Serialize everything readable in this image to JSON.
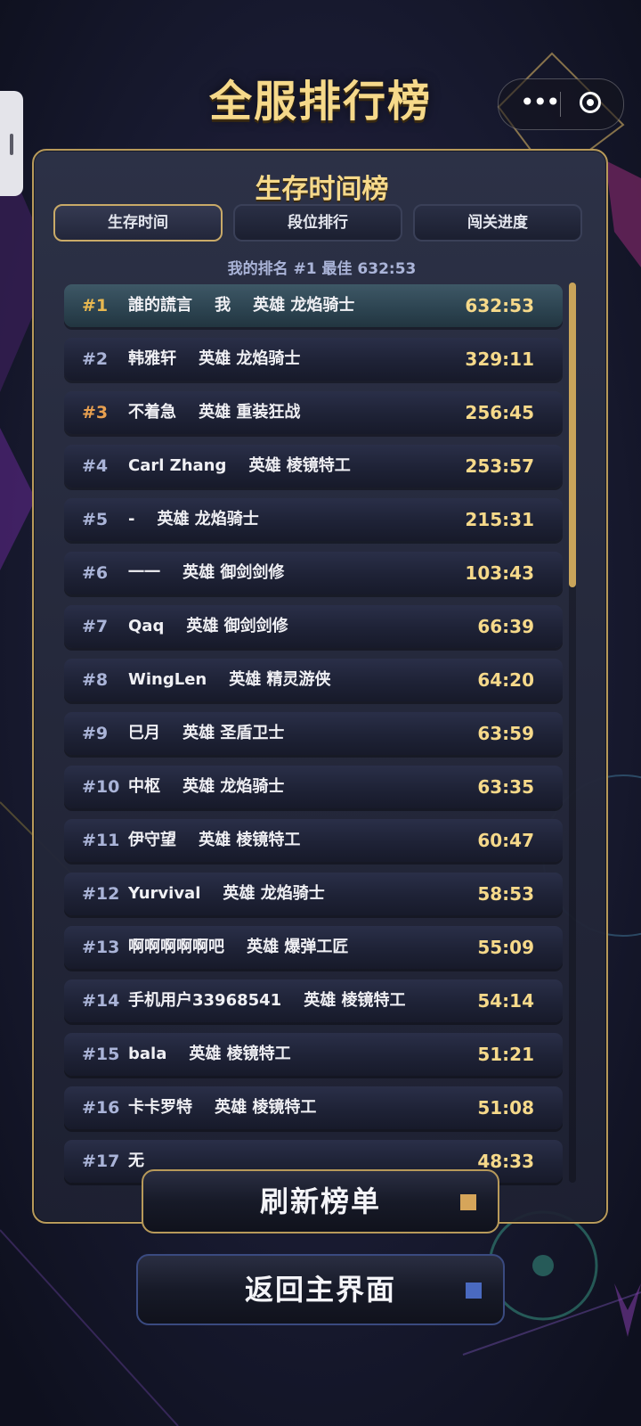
{
  "title": "全服排行榜",
  "panel": {
    "title": "生存时间榜",
    "tabs": [
      {
        "label": "生存时间",
        "active": true
      },
      {
        "label": "段位排行",
        "active": false
      },
      {
        "label": "闯关进度",
        "active": false
      }
    ],
    "my_rank": "我的排名 #1  最佳 632:53"
  },
  "rows": [
    {
      "rank": "#1",
      "name": "誰的謊言    我    英雄 龙焰骑士",
      "time": "632:53"
    },
    {
      "rank": "#2",
      "name": "韩雅轩    英雄 龙焰骑士",
      "time": "329:11"
    },
    {
      "rank": "#3",
      "name": "不着急    英雄 重装狂战",
      "time": "256:45"
    },
    {
      "rank": "#4",
      "name": "Carl Zhang    英雄 棱镜特工",
      "time": "253:57"
    },
    {
      "rank": "#5",
      "name": "-    英雄 龙焰骑士",
      "time": "215:31"
    },
    {
      "rank": "#6",
      "name": "一一    英雄 御剑剑修",
      "time": "103:43"
    },
    {
      "rank": "#7",
      "name": "Qaq    英雄 御剑剑修",
      "time": "66:39"
    },
    {
      "rank": "#8",
      "name": "WingLen    英雄 精灵游侠",
      "time": "64:20"
    },
    {
      "rank": "#9",
      "name": "巳月    英雄 圣盾卫士",
      "time": "63:59"
    },
    {
      "rank": "#10",
      "name": "中枢    英雄 龙焰骑士",
      "time": "63:35"
    },
    {
      "rank": "#11",
      "name": "伊守望    英雄 棱镜特工",
      "time": "60:47"
    },
    {
      "rank": "#12",
      "name": "Yurvival    英雄 龙焰骑士",
      "time": "58:53"
    },
    {
      "rank": "#13",
      "name": "啊啊啊啊啊吧    英雄 爆弹工匠",
      "time": "55:09"
    },
    {
      "rank": "#14",
      "name": "手机用户33968541    英雄 棱镜特工",
      "time": "54:14"
    },
    {
      "rank": "#15",
      "name": "bala    英雄 棱镜特工",
      "time": "51:21"
    },
    {
      "rank": "#16",
      "name": "卡卡罗特    英雄 棱镜特工",
      "time": "51:08"
    },
    {
      "rank": "#17",
      "name": "无",
      "time": "48:33"
    }
  ],
  "buttons": {
    "refresh": "刷新榜单",
    "back": "返回主界面"
  },
  "icons": {
    "capsule_menu": "more-dots-icon",
    "capsule_close": "close-target-icon"
  },
  "colors": {
    "accent_gold": "#f6d98a",
    "rank_first": "#e8b850",
    "rank_third": "#e8a050",
    "panel_border": "#b89a5a",
    "back_accent": "#4a6ac0"
  }
}
